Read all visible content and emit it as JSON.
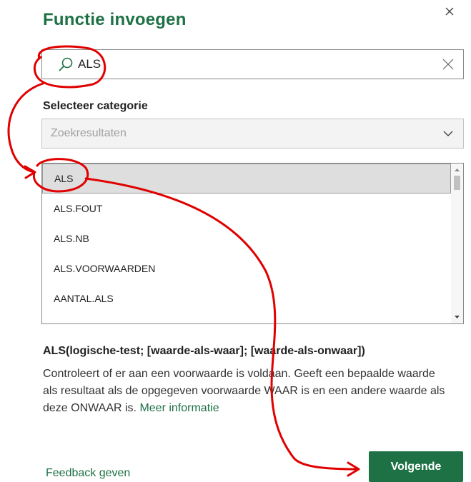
{
  "dialog": {
    "title": "Functie invoegen",
    "close_icon": "close-icon"
  },
  "search": {
    "value": "ALS",
    "icon": "search-icon",
    "clear_icon": "clear-icon"
  },
  "category": {
    "label": "Selecteer categorie",
    "selected": "Zoekresultaten",
    "icon": "chevron-down-icon"
  },
  "functions": {
    "items": [
      {
        "label": "ALS",
        "selected": true
      },
      {
        "label": "ALS.FOUT",
        "selected": false
      },
      {
        "label": "ALS.NB",
        "selected": false
      },
      {
        "label": "ALS.VOORWAARDEN",
        "selected": false
      },
      {
        "label": "AANTAL.ALS",
        "selected": false
      }
    ]
  },
  "detail": {
    "signature": "ALS(logische-test; [waarde-als-waar]; [waarde-als-onwaar])",
    "description": "Controleert of er aan een voorwaarde is voldaan. Geeft een bepaalde waarde als resultaat als de opgegeven voorwaarde WAAR is en een andere waarde als deze ONWAAR is.",
    "more_info_link": "Meer informatie"
  },
  "footer": {
    "feedback_link": "Feedback geven",
    "next_button": "Volgende"
  },
  "colors": {
    "accent": "#1e7145",
    "annotation": "#e00000"
  }
}
